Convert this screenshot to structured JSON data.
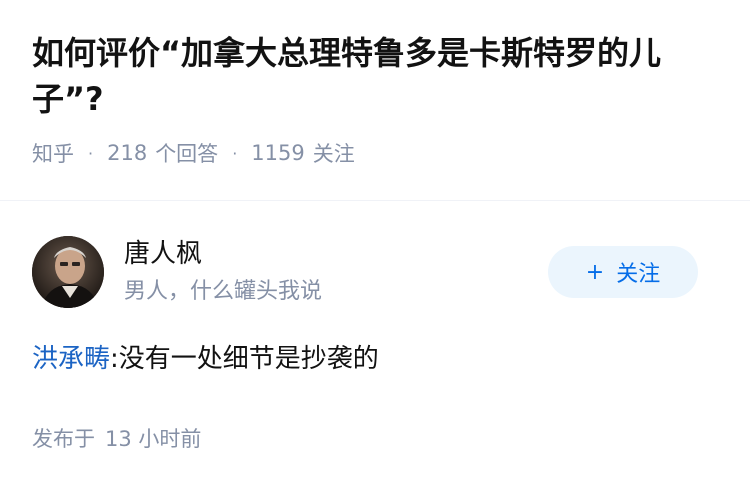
{
  "question": {
    "title": "如何评价“加拿大总理特鲁多是卡斯特罗的儿子”?",
    "source": "知乎",
    "answer_count": "218",
    "answer_label": "个回答",
    "follower_count": "1159",
    "follower_label": "关注"
  },
  "author": {
    "name": "唐人枫",
    "headline": "男人，什么罐头我说",
    "follow_plus": "+",
    "follow_label": "关注",
    "avatar_icon": "portrait-photo"
  },
  "answer": {
    "mention": "洪承畴",
    "separator": ":",
    "text": "没有一处细节是抄袭的"
  },
  "meta": {
    "published_label": "发布于",
    "published_time": "13 小时前"
  },
  "colors": {
    "text": "#121212",
    "meta": "#8590a6",
    "link": "#1c64c4",
    "accent": "#056de8",
    "follow_bg": "#ebf5fd"
  }
}
